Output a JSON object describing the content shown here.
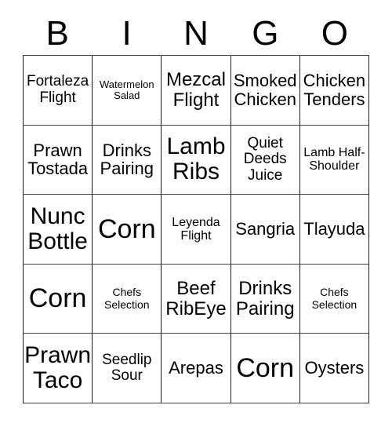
{
  "card": {
    "title_letters": [
      "B",
      "I",
      "N",
      "G",
      "O"
    ],
    "colors": {
      "background": "#ffffff",
      "text": "#000000",
      "grid_border": "#1a1a1a"
    },
    "rows": [
      [
        {
          "label": "Fortaleza Flight",
          "size": "sm"
        },
        {
          "label": "Watermelon Salad",
          "size": "tiny"
        },
        {
          "label": "Mezcal Flight",
          "size": "lg"
        },
        {
          "label": "Smoked Chicken",
          "size": "md"
        },
        {
          "label": "Chicken Tenders",
          "size": "md"
        }
      ],
      [
        {
          "label": "Prawn Tostada",
          "size": "md"
        },
        {
          "label": "Drinks Pairing",
          "size": "md"
        },
        {
          "label": "Lamb Ribs",
          "size": "xl"
        },
        {
          "label": "Quiet Deeds Juice",
          "size": "sm"
        },
        {
          "label": "Lamb Half-Shoulder",
          "size": "xs"
        }
      ],
      [
        {
          "label": "Nunc Bottle",
          "size": "xl"
        },
        {
          "label": "Corn",
          "size": "xxl"
        },
        {
          "label": "Leyenda Flight",
          "size": "xs"
        },
        {
          "label": "Sangria",
          "size": "md"
        },
        {
          "label": "Tlayuda",
          "size": "md"
        }
      ],
      [
        {
          "label": "Corn",
          "size": "xxl"
        },
        {
          "label": "Chefs Selection",
          "size": "xxs"
        },
        {
          "label": "Beef RibEye",
          "size": "lg"
        },
        {
          "label": "Drinks Pairing",
          "size": "lg"
        },
        {
          "label": "Chefs Selection",
          "size": "xxs"
        }
      ],
      [
        {
          "label": "Prawn Taco",
          "size": "xl"
        },
        {
          "label": "Seedlip Sour",
          "size": "sm"
        },
        {
          "label": "Arepas",
          "size": "md"
        },
        {
          "label": "Corn",
          "size": "xxl"
        },
        {
          "label": "Oysters",
          "size": "md"
        }
      ]
    ]
  }
}
